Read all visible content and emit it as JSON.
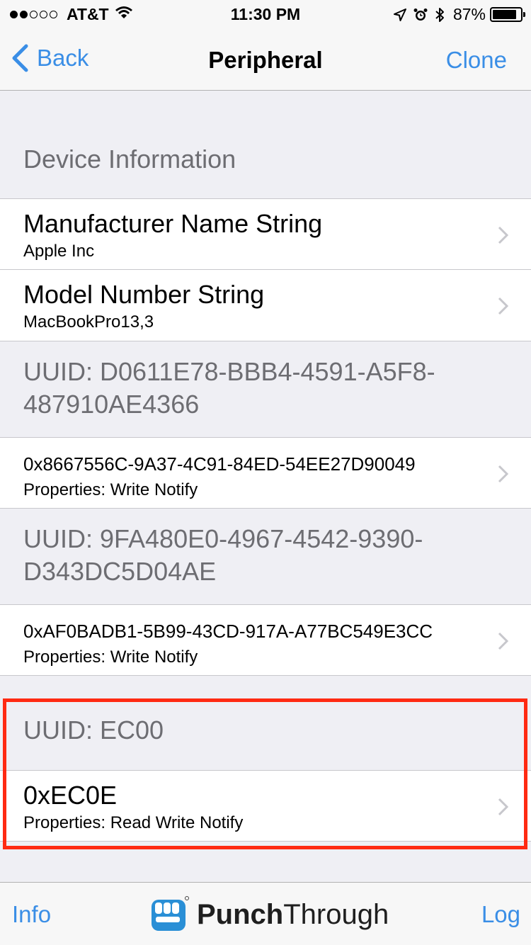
{
  "status_bar": {
    "carrier": "AT&T",
    "time": "11:30 PM",
    "battery_percent": "87%",
    "battery_level": 0.87,
    "signal_bars": 2
  },
  "nav": {
    "back_label": "Back",
    "title": "Peripheral",
    "clone_label": "Clone"
  },
  "sections": {
    "device_info": {
      "header": "Device Information",
      "cells": [
        {
          "title": "Manufacturer Name String",
          "subtitle": "Apple Inc"
        },
        {
          "title": "Model Number String",
          "subtitle": "MacBookPro13,3"
        }
      ]
    },
    "service1": {
      "header": "UUID: D0611E78-BBB4-4591-A5F8-487910AE4366",
      "cell": {
        "title": "0x8667556C-9A37-4C91-84ED-54EE27D90049",
        "subtitle": "Properties: Write Notify"
      }
    },
    "service2": {
      "header": "UUID: 9FA480E0-4967-4542-9390-D343DC5D04AE",
      "cell": {
        "title": "0xAF0BADB1-5B99-43CD-917A-A77BC549E3CC",
        "subtitle": "Properties: Write Notify"
      }
    },
    "service3": {
      "header": "UUID: EC00",
      "cell": {
        "title": "0xEC0E",
        "subtitle": "Properties: Read Write Notify"
      }
    }
  },
  "toolbar": {
    "info_label": "Info",
    "log_label": "Log",
    "logo_bold": "Punch",
    "logo_regular": "Through"
  },
  "colors": {
    "accent": "#3a8ee6",
    "highlight": "#ff2a12",
    "background": "#efeff4",
    "header_text": "#6d6d72"
  }
}
